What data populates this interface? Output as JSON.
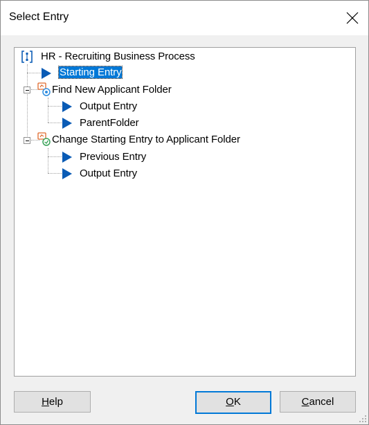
{
  "window": {
    "title": "Select Entry"
  },
  "tree": {
    "root": {
      "label": "HR - Recruiting Business Process"
    },
    "starting_entry": {
      "label": "Starting Entry"
    },
    "find_folder": {
      "label": "Find New Applicant Folder",
      "children": [
        {
          "label": "Output Entry"
        },
        {
          "label": "ParentFolder"
        }
      ]
    },
    "change_entry": {
      "label": "Change Starting Entry to Applicant Folder",
      "children": [
        {
          "label": "Previous Entry"
        },
        {
          "label": "Output Entry"
        }
      ]
    }
  },
  "buttons": {
    "help": {
      "mnemonic": "H",
      "rest": "elp"
    },
    "ok": {
      "mnemonic": "O",
      "rest": "K"
    },
    "cancel": {
      "mnemonic": "C",
      "rest": "ancel"
    }
  },
  "colors": {
    "selection": "#0078d7",
    "arrow": "#0a5bb5",
    "default_button_border": "#0078d7"
  },
  "icons": [
    "close-icon",
    "process-icon",
    "arrow-icon",
    "search-activity-icon",
    "route-activity-icon",
    "resize-grip-icon"
  ]
}
